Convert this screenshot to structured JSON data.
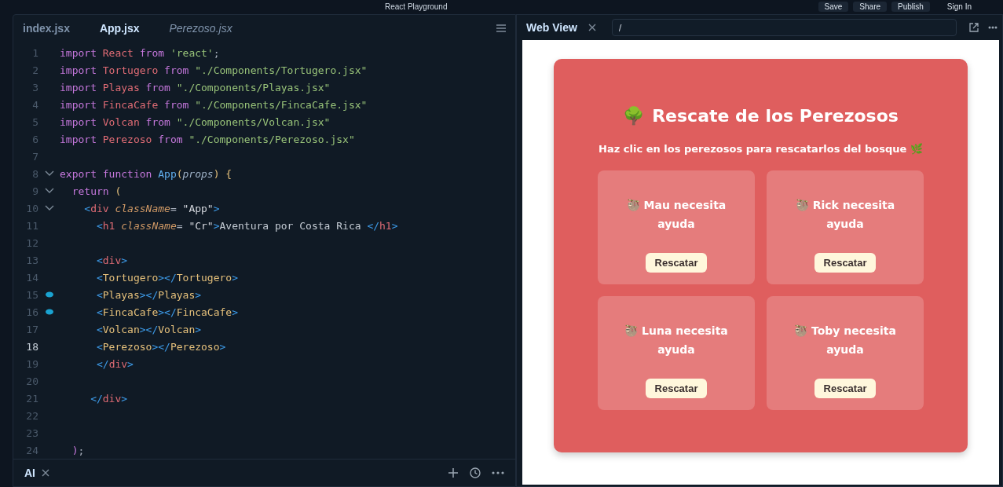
{
  "topbar": {
    "title": "React Playground",
    "buttons": [
      {
        "label": "Save"
      },
      {
        "label": "Share"
      },
      {
        "label": "Publish"
      }
    ],
    "sign_in": "Sign In"
  },
  "editor": {
    "tabs": [
      {
        "label": "index.jsx",
        "selected": false,
        "italic": false
      },
      {
        "label": "App.jsx",
        "selected": true,
        "italic": false
      },
      {
        "label": "Perezoso.jsx",
        "selected": false,
        "italic": true
      }
    ],
    "lines": [
      {
        "n": "1",
        "fold": false,
        "marker": false,
        "current": false,
        "tokens": [
          {
            "kind": "kw",
            "text": "import "
          },
          {
            "kind": "id",
            "text": "React "
          },
          {
            "kind": "kw",
            "text": "from "
          },
          {
            "kind": "str",
            "text": "'react'"
          },
          {
            "kind": "p",
            "text": ";"
          }
        ]
      },
      {
        "n": "2",
        "fold": false,
        "marker": false,
        "current": false,
        "tokens": [
          {
            "kind": "kw",
            "text": "import "
          },
          {
            "kind": "id",
            "text": "Tortugero "
          },
          {
            "kind": "kw",
            "text": "from "
          },
          {
            "kind": "str",
            "text": "\"./Components/Tortugero.jsx\""
          }
        ]
      },
      {
        "n": "3",
        "fold": false,
        "marker": false,
        "current": false,
        "tokens": [
          {
            "kind": "kw",
            "text": "import "
          },
          {
            "kind": "id",
            "text": "Playas "
          },
          {
            "kind": "kw",
            "text": "from "
          },
          {
            "kind": "str",
            "text": "\"./Components/Playas.jsx\""
          }
        ]
      },
      {
        "n": "4",
        "fold": false,
        "marker": false,
        "current": false,
        "tokens": [
          {
            "kind": "kw",
            "text": "import "
          },
          {
            "kind": "id",
            "text": "FincaCafe "
          },
          {
            "kind": "kw",
            "text": "from "
          },
          {
            "kind": "str",
            "text": "\"./Components/FincaCafe.jsx\""
          }
        ]
      },
      {
        "n": "5",
        "fold": false,
        "marker": false,
        "current": false,
        "tokens": [
          {
            "kind": "kw",
            "text": "import "
          },
          {
            "kind": "id",
            "text": "Volcan "
          },
          {
            "kind": "kw",
            "text": "from "
          },
          {
            "kind": "str",
            "text": "\"./Components/Volcan.jsx\""
          }
        ]
      },
      {
        "n": "6",
        "fold": false,
        "marker": false,
        "current": false,
        "tokens": [
          {
            "kind": "kw",
            "text": "import "
          },
          {
            "kind": "id",
            "text": "Perezoso "
          },
          {
            "kind": "kw",
            "text": "from "
          },
          {
            "kind": "str",
            "text": "\"./Components/Perezoso.jsx\""
          }
        ]
      },
      {
        "n": "7",
        "fold": false,
        "marker": false,
        "current": false
      },
      {
        "n": "8",
        "fold": true,
        "marker": false,
        "current": false,
        "tokens": [
          {
            "kind": "kw",
            "text": "export function "
          },
          {
            "kind": "fn",
            "text": "App"
          },
          {
            "kind": "br",
            "text": "("
          },
          {
            "kind": "param",
            "text": "props"
          },
          {
            "kind": "br",
            "text": ") {"
          }
        ]
      },
      {
        "n": "9",
        "fold": true,
        "marker": false,
        "current": false,
        "tokens": [
          {
            "kind": "kw",
            "text": "  return "
          },
          {
            "kind": "br",
            "text": "("
          }
        ]
      },
      {
        "n": "10",
        "fold": true,
        "marker": false,
        "current": false,
        "tokens": [
          {
            "kind": "tag",
            "text": "    <"
          },
          {
            "kind": "tn",
            "text": "div "
          },
          {
            "kind": "attr",
            "text": "className"
          },
          {
            "kind": "p",
            "text": "= "
          },
          {
            "kind": "av",
            "text": "\"App\""
          },
          {
            "kind": "tag",
            "text": ">"
          }
        ]
      },
      {
        "n": "11",
        "fold": false,
        "marker": false,
        "current": false,
        "tokens": [
          {
            "kind": "tag",
            "text": "      <"
          },
          {
            "kind": "tn",
            "text": "h1 "
          },
          {
            "kind": "attr",
            "text": "className"
          },
          {
            "kind": "p",
            "text": "= "
          },
          {
            "kind": "av",
            "text": "\"Cr\""
          },
          {
            "kind": "tag",
            "text": ">"
          },
          {
            "kind": "txt",
            "text": "Aventura por Costa Rica "
          },
          {
            "kind": "tag",
            "text": "</"
          },
          {
            "kind": "tn",
            "text": "h1"
          },
          {
            "kind": "tag",
            "text": ">"
          }
        ]
      },
      {
        "n": "12",
        "fold": false,
        "marker": false,
        "current": false
      },
      {
        "n": "13",
        "fold": false,
        "marker": false,
        "current": false,
        "tokens": [
          {
            "kind": "tag",
            "text": "      <"
          },
          {
            "kind": "tn",
            "text": "div"
          },
          {
            "kind": "tag",
            "text": ">"
          }
        ]
      },
      {
        "n": "14",
        "fold": false,
        "marker": false,
        "current": false,
        "tokens": [
          {
            "kind": "tag",
            "text": "      <"
          },
          {
            "kind": "comp",
            "text": "Tortugero"
          },
          {
            "kind": "tag",
            "text": "></"
          },
          {
            "kind": "comp",
            "text": "Tortugero"
          },
          {
            "kind": "tag",
            "text": ">"
          }
        ]
      },
      {
        "n": "15",
        "fold": false,
        "marker": true,
        "current": false,
        "tokens": [
          {
            "kind": "tag",
            "text": "      <"
          },
          {
            "kind": "comp",
            "text": "Playas"
          },
          {
            "kind": "tag",
            "text": "></"
          },
          {
            "kind": "comp",
            "text": "Playas"
          },
          {
            "kind": "tag",
            "text": ">"
          }
        ]
      },
      {
        "n": "16",
        "fold": false,
        "marker": true,
        "current": false,
        "tokens": [
          {
            "kind": "tag",
            "text": "      <"
          },
          {
            "kind": "comp",
            "text": "FincaCafe"
          },
          {
            "kind": "tag",
            "text": "></"
          },
          {
            "kind": "comp",
            "text": "FincaCafe"
          },
          {
            "kind": "tag",
            "text": ">"
          }
        ]
      },
      {
        "n": "17",
        "fold": false,
        "marker": false,
        "current": false,
        "tokens": [
          {
            "kind": "tag",
            "text": "      <"
          },
          {
            "kind": "comp",
            "text": "Volcan"
          },
          {
            "kind": "tag",
            "text": "></"
          },
          {
            "kind": "comp",
            "text": "Volcan"
          },
          {
            "kind": "tag",
            "text": ">"
          }
        ]
      },
      {
        "n": "18",
        "fold": false,
        "marker": false,
        "current": true,
        "tokens": [
          {
            "kind": "tag",
            "text": "      <"
          },
          {
            "kind": "comp",
            "text": "Perezoso"
          },
          {
            "kind": "tag",
            "text": "></"
          },
          {
            "kind": "comp",
            "text": "Perezoso"
          },
          {
            "kind": "tag",
            "text": ">"
          }
        ]
      },
      {
        "n": "19",
        "fold": false,
        "marker": false,
        "current": false,
        "tokens": [
          {
            "kind": "tag",
            "text": "      </"
          },
          {
            "kind": "tn",
            "text": "div"
          },
          {
            "kind": "tag",
            "text": ">"
          }
        ]
      },
      {
        "n": "20",
        "fold": false,
        "marker": false,
        "current": false
      },
      {
        "n": "21",
        "fold": false,
        "marker": false,
        "current": false,
        "tokens": [
          {
            "kind": "tag",
            "text": "     </"
          },
          {
            "kind": "tn",
            "text": "div"
          },
          {
            "kind": "tag",
            "text": ">"
          }
        ]
      },
      {
        "n": "22",
        "fold": false,
        "marker": false,
        "current": false
      },
      {
        "n": "23",
        "fold": false,
        "marker": false,
        "current": false
      },
      {
        "n": "24",
        "fold": false,
        "marker": false,
        "current": false,
        "tokens": [
          {
            "kind": "kw",
            "text": "  )"
          },
          {
            "kind": "p",
            "text": ";"
          }
        ]
      }
    ]
  },
  "ai_panel": {
    "tab": "AI"
  },
  "web_view": {
    "tab": "Web View",
    "url": "/",
    "app": {
      "title_icon": "🌳",
      "title": "Rescate de los Perezosos",
      "subtitle": "Haz clic en los perezosos para rescatarlos del bosque 🌿",
      "cards": [
        {
          "icon": "🦥",
          "text": "Mau necesita ayuda",
          "button": "Rescatar"
        },
        {
          "icon": "🦥",
          "text": "Rick necesita ayuda",
          "button": "Rescatar"
        },
        {
          "icon": "🦥",
          "text": "Luna necesita ayuda",
          "button": "Rescatar"
        },
        {
          "icon": "🦥",
          "text": "Toby necesita ayuda",
          "button": "Rescatar"
        }
      ]
    }
  }
}
